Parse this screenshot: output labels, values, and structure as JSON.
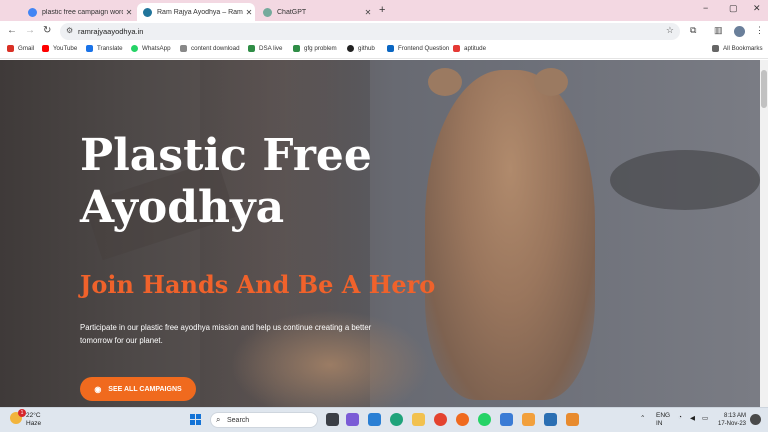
{
  "tabs": [
    {
      "title": "plastic free campaign wordpre",
      "active": false
    },
    {
      "title": "Ram Rajya Ayodhya – Ram Raj",
      "active": true
    },
    {
      "title": "ChatGPT",
      "active": false
    }
  ],
  "browser": {
    "new_tab": "+",
    "url": "ramrajyaayodhya.in",
    "minimize": "−",
    "restore": "▢",
    "close": "✕"
  },
  "bookmarks": [
    {
      "label": "Gmail",
      "color": "#d93025"
    },
    {
      "label": "YouTube",
      "color": "#ff0000"
    },
    {
      "label": "Translate",
      "color": "#1a73e8"
    },
    {
      "label": "WhatsApp",
      "color": "#25d366"
    },
    {
      "label": "content download",
      "color": "#888888"
    },
    {
      "label": "DSA live",
      "color": "#2f8d46"
    },
    {
      "label": "gfg problem",
      "color": "#2f8d46"
    },
    {
      "label": "github",
      "color": "#222222"
    },
    {
      "label": "Frontend Question",
      "color": "#0a66c2"
    },
    {
      "label": "aptitude",
      "color": "#e53935"
    }
  ],
  "all_bookmarks": "All Bookmarks",
  "hero": {
    "title_line1": "Plastic Free",
    "title_line2": "Ayodhya",
    "subtitle": "Join Hands And Be A Hero",
    "description": "Participate in our plastic free ayodhya mission and help us continue creating a better tomorrow for our planet.",
    "cta_label": "SEE ALL CAMPAIGNS",
    "accent_color": "#f06a1e"
  },
  "taskbar": {
    "temperature": "22°C",
    "weather": "Haze",
    "weather_badge": "1",
    "search_placeholder": "Search",
    "lang_line1": "ENG",
    "lang_line2": "IN",
    "time": "8:13 AM",
    "date": "17-Nov-23"
  }
}
